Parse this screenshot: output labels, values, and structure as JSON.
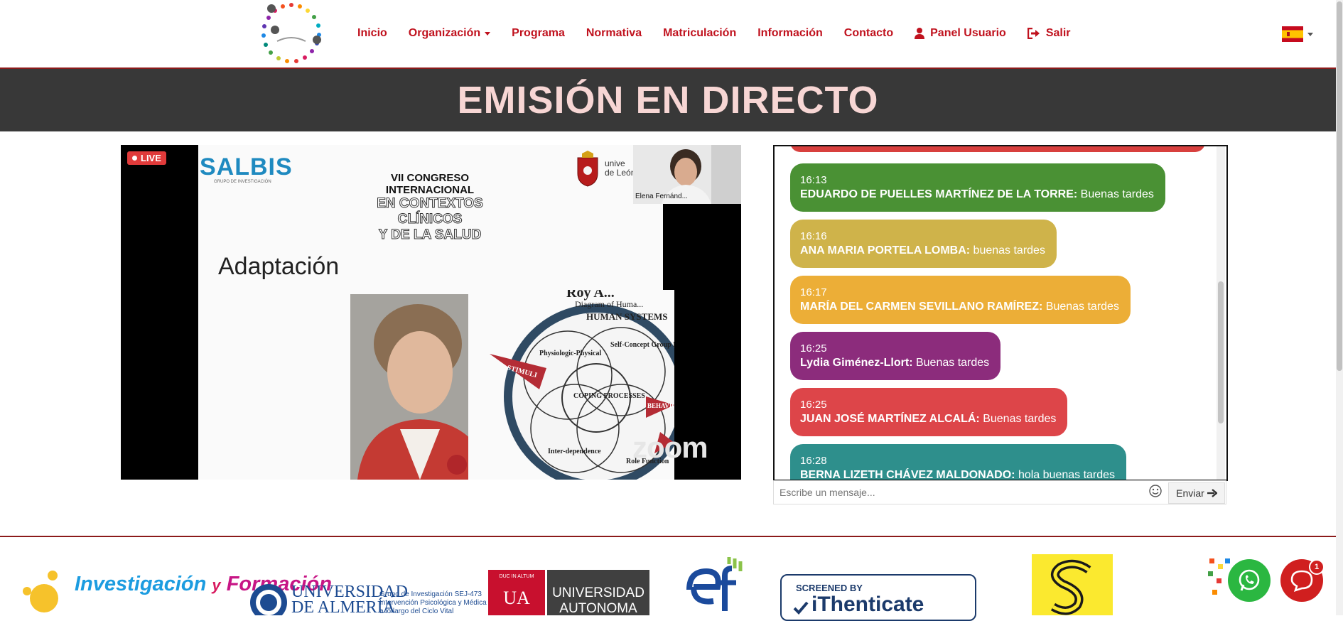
{
  "nav": {
    "items": [
      {
        "label": "Inicio"
      },
      {
        "label": "Organización"
      },
      {
        "label": "Programa"
      },
      {
        "label": "Normativa"
      },
      {
        "label": "Matriculación"
      },
      {
        "label": "Información"
      },
      {
        "label": "Contacto"
      },
      {
        "label": "Panel Usuario",
        "icon": "user-icon"
      },
      {
        "label": "Salir",
        "icon": "sign-out-icon"
      }
    ],
    "language_icon": "spain-flag-icon"
  },
  "banner": {
    "title": "EMISIÓN EN DIRECTO"
  },
  "video": {
    "live_label": "LIVE",
    "slide": {
      "logo_text": "SALBIS",
      "logo_sub": "GRUPO DE INVESTIGACIÓN",
      "congress_line1": "VII CONGRESO INTERNACIONAL",
      "congress_line2": "EN CONTEXTOS CLÍNICOS",
      "congress_line3": "Y DE LA SALUD",
      "university_fragment_1": "unive",
      "university_fragment_2": "de León",
      "title": "Adaptación",
      "diagram_title": "Roy A...",
      "diagram_caption": "Diagram of Huma...",
      "diagram_header": "HUMAN SYSTEMS",
      "labels": [
        "STIMULI",
        "Physiologic-Physical",
        "Self-Concept Group Identity",
        "COPING PROCESSES",
        "BEHAVIOR",
        "Inter-dependence",
        "Role Function"
      ],
      "watermark": "zoom"
    },
    "pip_name": "Elena Fernánd..."
  },
  "chat": {
    "messages": [
      {
        "time": "16:13",
        "author": "EDUARDO DE PUELLES MARTÍNEZ DE LA TORRE:",
        "text": " Buenas tardes",
        "color": "#4a9134"
      },
      {
        "time": "16:16",
        "author": "ANA MARIA PORTELA LOMBA:",
        "text": " buenas tardes",
        "color": "#cfb34a"
      },
      {
        "time": "16:17",
        "author": "MARÍA DEL CARMEN SEVILLANO RAMÍREZ:",
        "text": " Buenas tardes",
        "color": "#ecae37"
      },
      {
        "time": "16:25",
        "author": "Lydia Giménez-Llort:",
        "text": " Buenas tardes",
        "color": "#8c2c7c"
      },
      {
        "time": "16:25",
        "author": "JUAN JOSÉ MARTÍNEZ ALCALÁ:",
        "text": " Buenas tardes",
        "color": "#dd4549"
      },
      {
        "time": "16:28",
        "author": "BERNA LIZETH CHÁVEZ MALDONADO:",
        "text": " hola buenas tardes",
        "color": "#2e8f8c"
      }
    ],
    "input_placeholder": "Escribe un mensaje...",
    "send_label": "Enviar"
  },
  "footer": {
    "if_word1": "Investigación",
    "if_y": "y",
    "if_word2": "Formación",
    "ual_line1": "UNIVERSIDAD",
    "ual_line2": "DE ALMERÍA",
    "sej_line1": "Grupo de Investigación SEJ-473",
    "sej_line2": "Intervención Psicológica y Médica",
    "sej_line3": "a lo largo del Ciclo Vital",
    "ua_motto": "DUC IN ALTUM",
    "ua_short": "UA",
    "ua_line1": "UNIVERSIDAD",
    "ua_line2": "AUTONOMA",
    "ith_screened": "SCREENED BY",
    "ith_name": "iThenticate",
    "chat_badge": "1"
  }
}
